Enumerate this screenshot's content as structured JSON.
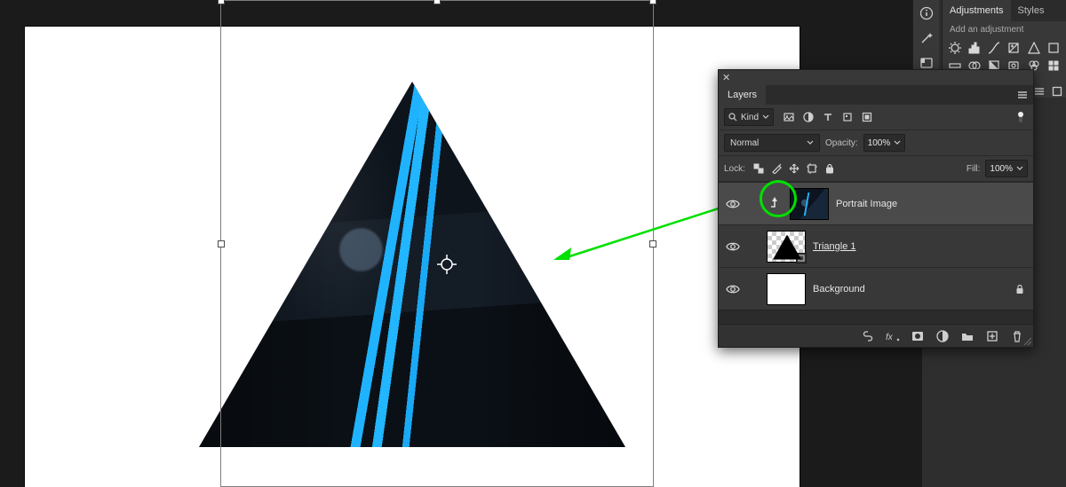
{
  "adjustments": {
    "tab_adjustments": "Adjustments",
    "tab_styles": "Styles",
    "hint": "Add an adjustment"
  },
  "layers_panel": {
    "tab_label": "Layers",
    "kind_filter": "Kind",
    "blend_mode": "Normal",
    "opacity_label": "Opacity:",
    "opacity_value": "100%",
    "lock_label": "Lock:",
    "fill_label": "Fill:",
    "fill_value": "100%",
    "layers": {
      "portrait": "Portrait Image",
      "triangle": "Triangle 1",
      "background": "Background"
    }
  },
  "icons": {
    "info": "info",
    "wand": "wand",
    "swatch": "swatch"
  }
}
